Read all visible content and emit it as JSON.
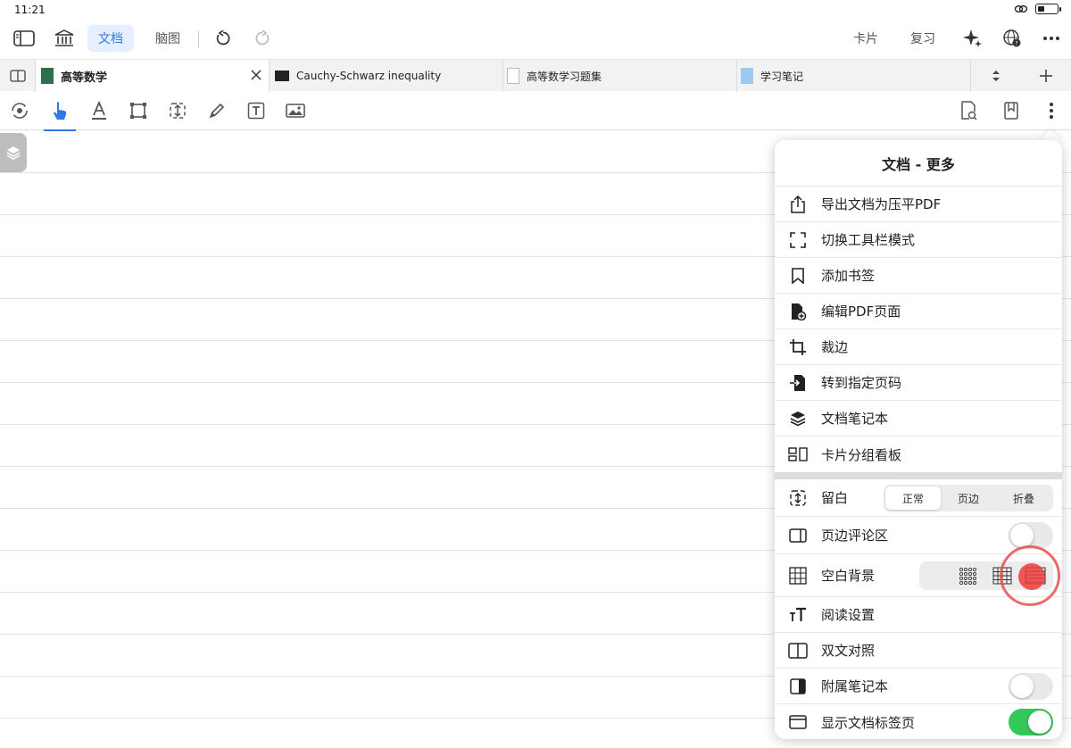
{
  "status": {
    "time": "11:21"
  },
  "topbar": {
    "doc_label": "文档",
    "mind_label": "脑图",
    "card_label": "卡片",
    "review_label": "复习"
  },
  "tabs": [
    {
      "label": "高等数学",
      "active": true
    },
    {
      "label": "Cauchy-Schwarz inequality",
      "active": false
    },
    {
      "label": "高等数学习题集",
      "active": false
    },
    {
      "label": "学习笔记",
      "active": false
    }
  ],
  "popover": {
    "title": "文档 - 更多",
    "items": [
      {
        "label": "导出文档为压平PDF",
        "icon": "share-icon"
      },
      {
        "label": "切换工具栏模式",
        "icon": "expand-icon"
      },
      {
        "label": "添加书签",
        "icon": "bookmark-icon"
      },
      {
        "label": "编辑PDF页面",
        "icon": "file-edit-icon"
      },
      {
        "label": "裁边",
        "icon": "crop-icon"
      },
      {
        "label": "转到指定页码",
        "icon": "goto-page-icon"
      },
      {
        "label": "文档笔记本",
        "icon": "layers-icon"
      },
      {
        "label": "卡片分组看板",
        "icon": "board-icon"
      }
    ],
    "margin": {
      "label": "留白",
      "options": [
        "正常",
        "页边",
        "折叠"
      ],
      "selected": "正常"
    },
    "margin_comments": {
      "label": "页边评论区",
      "on": false
    },
    "blank_bg": {
      "label": "空白背景"
    },
    "reading": {
      "label": "阅读设置"
    },
    "bilingual": {
      "label": "双文对照"
    },
    "attached_notebook": {
      "label": "附属笔记本",
      "on": false
    },
    "show_tabs": {
      "label": "显示文档标签页",
      "on": true
    }
  },
  "colors": {
    "accent": "#2e7be6",
    "toggle_on": "#34c759"
  }
}
